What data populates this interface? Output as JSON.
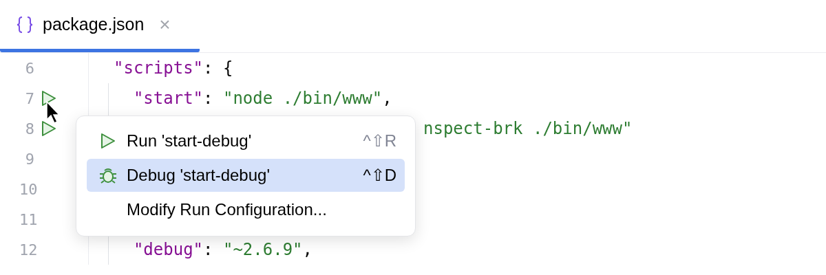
{
  "tabs": [
    {
      "label": "package.json",
      "selected": true,
      "close": "×"
    }
  ],
  "editor": {
    "lines": [
      {
        "number": "6",
        "run": false,
        "kind": "full",
        "tokens": [
          {
            "kind": "key",
            "text": "\"scripts\""
          },
          {
            "kind": "punct",
            "text": ": {"
          }
        ]
      },
      {
        "number": "7",
        "run": true,
        "kind": "full",
        "tokens": [
          {
            "kind": "key",
            "text": "  \"start\""
          },
          {
            "kind": "punct",
            "text": ": "
          },
          {
            "kind": "string",
            "text": "\"node ./bin/www\""
          },
          {
            "kind": "punct",
            "text": ","
          }
        ]
      },
      {
        "number": "8",
        "run": true,
        "kind": "partial",
        "tokens": [
          {
            "kind": "string",
            "text": "nspect-brk ./bin/www\""
          }
        ]
      },
      {
        "number": "9",
        "run": false,
        "kind": "full"
      },
      {
        "number": "10",
        "run": false,
        "kind": "full"
      },
      {
        "number": "11",
        "run": false,
        "kind": "full"
      },
      {
        "number": "12",
        "run": false,
        "kind": "full",
        "tokens": [
          {
            "kind": "key",
            "text": "  \"debug\""
          },
          {
            "kind": "punct",
            "text": ": "
          },
          {
            "kind": "string",
            "text": "\"~2.6.9\""
          },
          {
            "kind": "punct",
            "text": ","
          }
        ]
      }
    ]
  },
  "popup": {
    "items": [
      {
        "kind": "run",
        "label": "Run 'start-debug'",
        "shortcut": "^⇧R",
        "selected": false
      },
      {
        "kind": "debug",
        "label": "Debug 'start-debug'",
        "shortcut": "^⇧D",
        "selected": true
      },
      {
        "kind": "plain",
        "label": "Modify Run Configuration...",
        "selected": false
      }
    ]
  }
}
